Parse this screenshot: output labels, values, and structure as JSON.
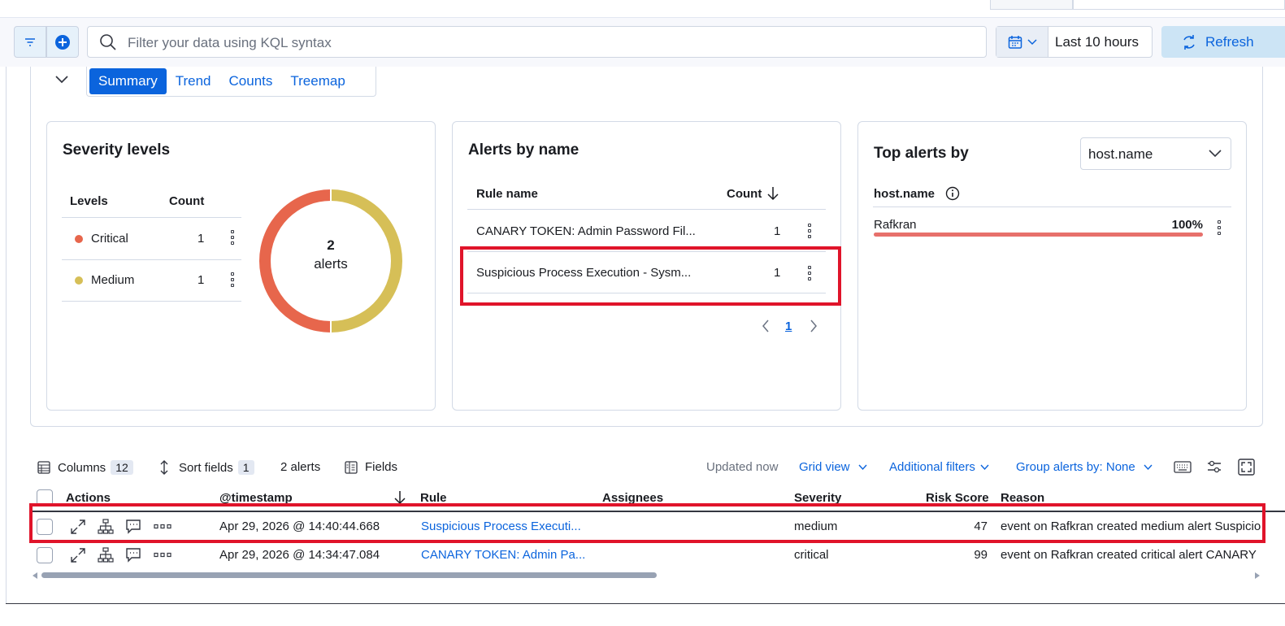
{
  "search": {
    "placeholder": "Filter your data using KQL syntax"
  },
  "date": {
    "range_label": "Last 10 hours"
  },
  "refresh": {
    "label": "Refresh"
  },
  "tabs": [
    "Summary",
    "Trend",
    "Counts",
    "Treemap"
  ],
  "severity_card": {
    "title": "Severity levels",
    "col_levels": "Levels",
    "col_count": "Count",
    "rows": [
      {
        "level": "Critical",
        "count": "1",
        "color": "#e7664c"
      },
      {
        "level": "Medium",
        "count": "1",
        "color": "#d6bf57"
      }
    ],
    "donut_total": "2",
    "donut_label": "alerts"
  },
  "alerts_card": {
    "title": "Alerts by name",
    "col_rule": "Rule name",
    "col_count": "Count",
    "rows": [
      {
        "rule": "CANARY TOKEN: Admin Password Fil...",
        "count": "1"
      },
      {
        "rule": "Suspicious Process Execution - Sysm...",
        "count": "1"
      }
    ],
    "page": "1"
  },
  "top_card": {
    "title": "Top alerts by",
    "field_select": "host.name",
    "col_field": "host.name",
    "rows": [
      {
        "name": "Rafkran",
        "pct": "100%",
        "fraction": 1.0
      }
    ]
  },
  "toolbar": {
    "columns_label": "Columns",
    "columns_count": "12",
    "sort_label": "Sort fields",
    "sort_count": "1",
    "alerts_count": "2 alerts",
    "fields_label": "Fields",
    "updated": "Updated now",
    "grid_view": "Grid view",
    "additional_filters": "Additional filters",
    "group_by": "Group alerts by: None"
  },
  "grid": {
    "headers": {
      "actions": "Actions",
      "timestamp": "@timestamp",
      "rule": "Rule",
      "assignees": "Assignees",
      "severity": "Severity",
      "risk": "Risk Score",
      "reason": "Reason"
    },
    "rows": [
      {
        "timestamp": "Apr 29, 2026 @ 14:40:44.668",
        "rule": "Suspicious Process Executi...",
        "severity": "medium",
        "risk": "47",
        "reason": "event on Rafkran created medium alert Suspicio"
      },
      {
        "timestamp": "Apr 29, 2026 @ 14:34:47.084",
        "rule": "CANARY TOKEN: Admin Pa...",
        "severity": "critical",
        "risk": "99",
        "reason": "event on Rafkran created critical alert CANARY"
      }
    ]
  }
}
